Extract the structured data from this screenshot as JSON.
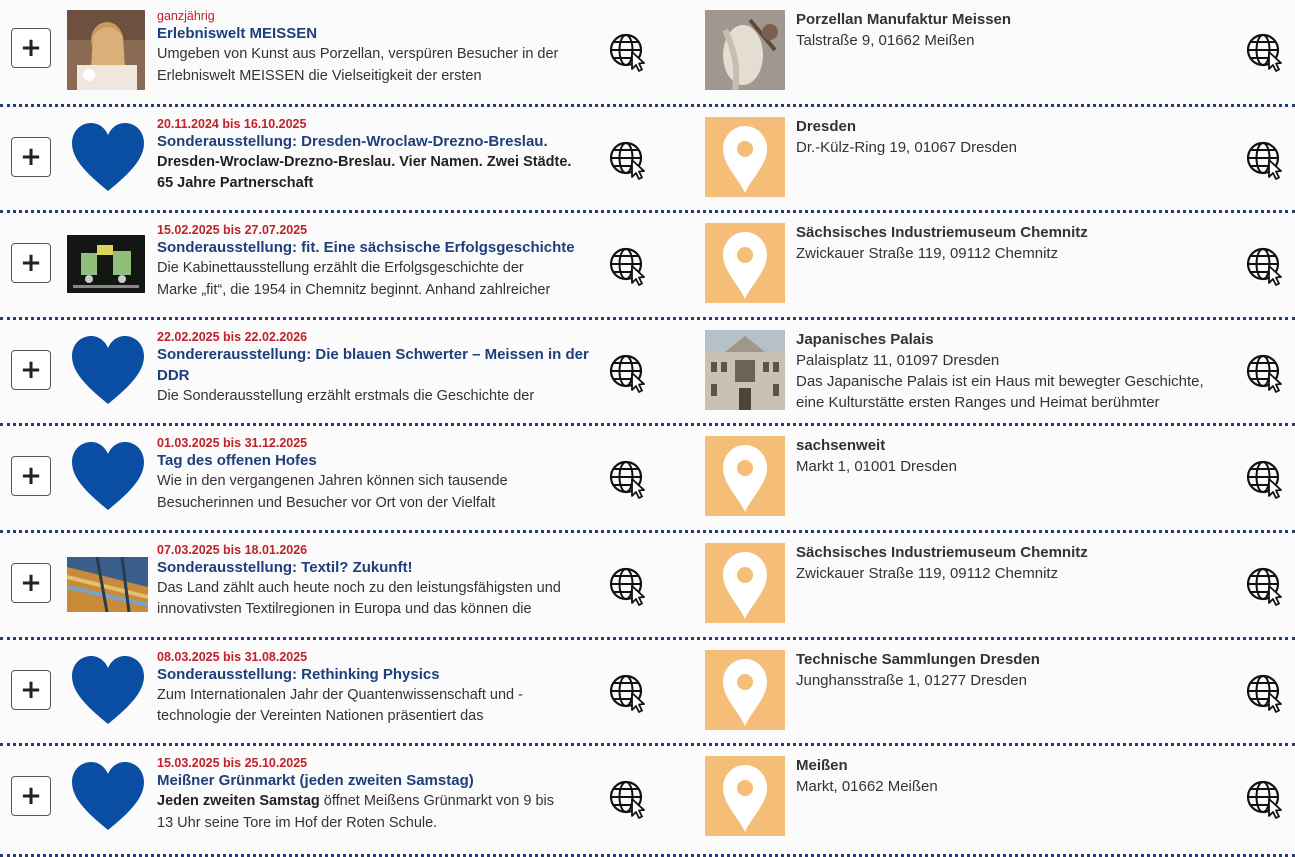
{
  "events": [
    {
      "date": "ganzjährig",
      "title": "Erlebniswelt MEISSEN",
      "desc": [
        "Umgeben von Kunst aus Porzellan, verspüren Besucher in der",
        "Erlebniswelt MEISSEN die Vielseitigkeit der ersten"
      ],
      "image": "photo-woman-painting-porcelain",
      "location": {
        "name": "Porzellan Manufaktur Meissen",
        "address": "Talstraße 9, 01662 Meißen",
        "image": "photo-porcelain-figure"
      }
    },
    {
      "date": "20.11.2024 bis 16.10.2025",
      "title": "Sonderausstellung: Dresden-Wroclaw-Drezno-Breslau.",
      "desc": [
        "Dresden-Wroclaw-Drezno-Breslau. Vier Namen. Zwei Städte.",
        "65 Jahre Partnerschaft"
      ],
      "image": "heart-icon",
      "location": {
        "name": "Dresden",
        "address": "Dr.-Külz-Ring 19, 01067 Dresden",
        "image": "map-pin-icon"
      }
    },
    {
      "date": "15.02.2025 bis 27.07.2025",
      "title": "Sonderausstellung: fit. Eine sächsische Erfolgsgeschichte",
      "desc": [
        "Die Kabinettausstellung erzählt die Erfolgsgeschichte der",
        "Marke „fit“, die 1954 in Chemnitz beginnt. Anhand zahlreicher"
      ],
      "image": "photo-fit-advertisement",
      "location": {
        "name": "Sächsisches Industriemuseum Chemnitz",
        "address": "Zwickauer Straße 119, 09112 Chemnitz",
        "image": "map-pin-icon"
      }
    },
    {
      "date": "22.02.2025 bis 22.02.2026",
      "title": "Sondererausstellung: Die blauen Schwerter – Meissen in der DDR",
      "desc": [
        "Die Sonderausstellung erzählt erstmals die Geschichte der"
      ],
      "image": "heart-icon",
      "location": {
        "name": "Japanisches Palais",
        "address": "Palaisplatz 11, 01097 Dresden",
        "desc": [
          "Das Japanische Palais ist ein Haus mit bewegter Geschichte,",
          "eine Kulturstätte ersten Ranges und Heimat berühmter"
        ],
        "image": "photo-japanisches-palais"
      }
    },
    {
      "date": "01.03.2025 bis 31.12.2025",
      "title": "Tag des offenen Hofes",
      "desc": [
        "Wie in den vergangenen Jahren können sich tausende",
        "Besucherinnen und Besucher vor Ort von der Vielfalt"
      ],
      "image": "heart-icon",
      "location": {
        "name": "sachsenweit",
        "address": "Markt 1, 01001 Dresden",
        "image": "map-pin-icon"
      }
    },
    {
      "date": "07.03.2025 bis 18.01.2026",
      "title": "Sonderausstellung: Textil? Zukunft!",
      "desc": [
        "Das Land zählt auch heute noch zu den leistungsfähigsten und",
        "innovativsten Textilregionen in Europa und das können die"
      ],
      "image": "photo-textile-threads",
      "location": {
        "name": "Sächsisches Industriemuseum Chemnitz",
        "address": "Zwickauer Straße 119, 09112 Chemnitz",
        "image": "map-pin-icon"
      }
    },
    {
      "date": "08.03.2025 bis 31.08.2025",
      "title": "Sonderausstellung: Rethinking Physics",
      "desc": [
        "Zum Internationalen Jahr der Quantenwissenschaft und -",
        "technologie der Vereinten Nationen präsentiert das"
      ],
      "image": "heart-icon",
      "location": {
        "name": "Technische Sammlungen Dresden",
        "address": "Junghansstraße 1, 01277 Dresden",
        "image": "map-pin-icon"
      }
    },
    {
      "date": "15.03.2025 bis 25.10.2025",
      "title": "Meißner Grünmarkt (jeden zweiten Samstag)",
      "desc_bold": "Jeden zweiten Samstag",
      "desc": [
        " öffnet Meißens Grünmarkt von 9 bis",
        "13 Uhr seine Tore im Hof der Roten Schule."
      ],
      "image": "heart-icon",
      "location": {
        "name": "Meißen",
        "address": "Markt, 01662 Meißen",
        "image": "map-pin-icon"
      }
    }
  ],
  "controls": {
    "expand_label": "+",
    "web_icon": "globe-cursor-icon"
  },
  "colors": {
    "date": "#c0222a",
    "title": "#1e3f7c",
    "heart": "#0a4ea3",
    "pin_background": "#f4bd78",
    "divider": "#1f3f75"
  }
}
